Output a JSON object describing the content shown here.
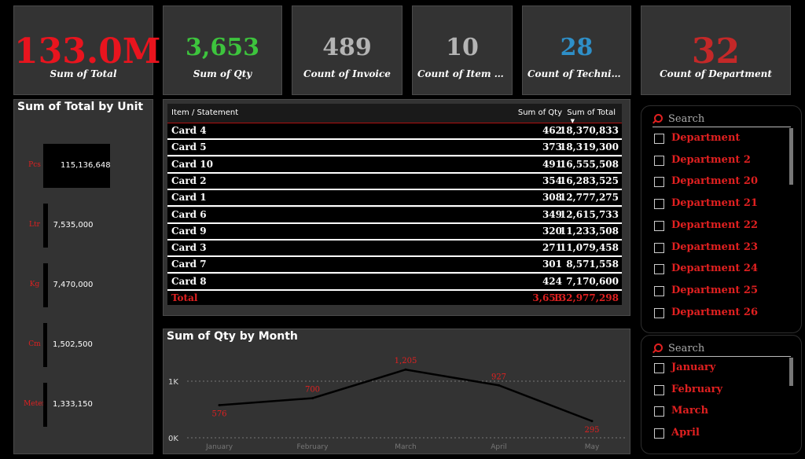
{
  "kpis": [
    {
      "value": "133.0M",
      "label": "Sum of Total",
      "color": "#e8141e"
    },
    {
      "value": "3,653",
      "label": "Sum of Qty",
      "color": "#3dc43d"
    },
    {
      "value": "489",
      "label": "Count of Invoice",
      "color": "#b4b4b4"
    },
    {
      "value": "10",
      "label": "Count of Item / Stat…",
      "color": "#b4b4b4"
    },
    {
      "value": "28",
      "label": "Count of Technicians",
      "color": "#2e8fc8"
    },
    {
      "value": "32",
      "label": "Count of Department",
      "color": "#c42828"
    }
  ],
  "unit_panel": {
    "title": "Sum of Total by Unit",
    "chart_data": {
      "type": "bar",
      "title": "Sum of Total by Unit",
      "categories": [
        "Pcs",
        "Ltr",
        "Kg",
        "Cm",
        "Meter"
      ],
      "values": [
        115136648,
        7535000,
        7470000,
        1502500,
        1333150
      ],
      "labels": [
        "115,136,648",
        "7,535,000",
        "7,470,000",
        "1,502,500",
        "1,333,150"
      ]
    }
  },
  "table": {
    "headers": [
      "Item / Statement",
      "Sum of Qty",
      "Sum of Total"
    ],
    "rows": [
      [
        "Card 4",
        "462",
        "18,370,833"
      ],
      [
        "Card 5",
        "373",
        "18,319,300"
      ],
      [
        "Card 10",
        "491",
        "16,555,508"
      ],
      [
        "Card 2",
        "354",
        "16,283,525"
      ],
      [
        "Card 1",
        "308",
        "12,777,275"
      ],
      [
        "Card 6",
        "349",
        "12,615,733"
      ],
      [
        "Card 9",
        "320",
        "11,233,508"
      ],
      [
        "Card 3",
        "271",
        "11,079,458"
      ],
      [
        "Card 7",
        "301",
        "8,571,558"
      ],
      [
        "Card 8",
        "424",
        "7,170,600"
      ]
    ],
    "total": [
      "Total",
      "3,653",
      "132,977,298"
    ]
  },
  "month_chart": {
    "title": "Sum of Qty by Month",
    "chart_data": {
      "type": "line",
      "title": "Sum of Qty by Month",
      "x": [
        "January",
        "February",
        "March",
        "April",
        "May"
      ],
      "values": [
        576,
        700,
        1205,
        927,
        295
      ],
      "labels": [
        "576",
        "700",
        "1,205",
        "927",
        "295"
      ],
      "y_ticks": [
        "0K",
        "1K"
      ],
      "ylim": [
        0,
        1500
      ]
    }
  },
  "dept_slicer": {
    "placeholder": "Search",
    "items": [
      "Department",
      "Department 2",
      "Department 20",
      "Department 21",
      "Department 22",
      "Department 23",
      "Department 24",
      "Department 25",
      "Department 26"
    ]
  },
  "month_slicer": {
    "placeholder": "Search",
    "items": [
      "January",
      "February",
      "March",
      "April"
    ]
  }
}
